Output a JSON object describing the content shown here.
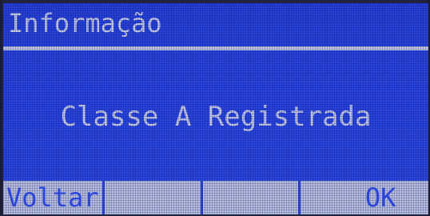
{
  "dialog": {
    "title": "Informação",
    "message": "Classe A Registrada"
  },
  "softkeys": {
    "key1_label": "Voltar",
    "key2_label": "",
    "key3_label": "",
    "key4_label": "OK"
  },
  "colors": {
    "screen_background": "#2944e0",
    "text": "#c8cce8",
    "softkey_background": "#b9bfdf",
    "softkey_text": "#2a45d8"
  }
}
